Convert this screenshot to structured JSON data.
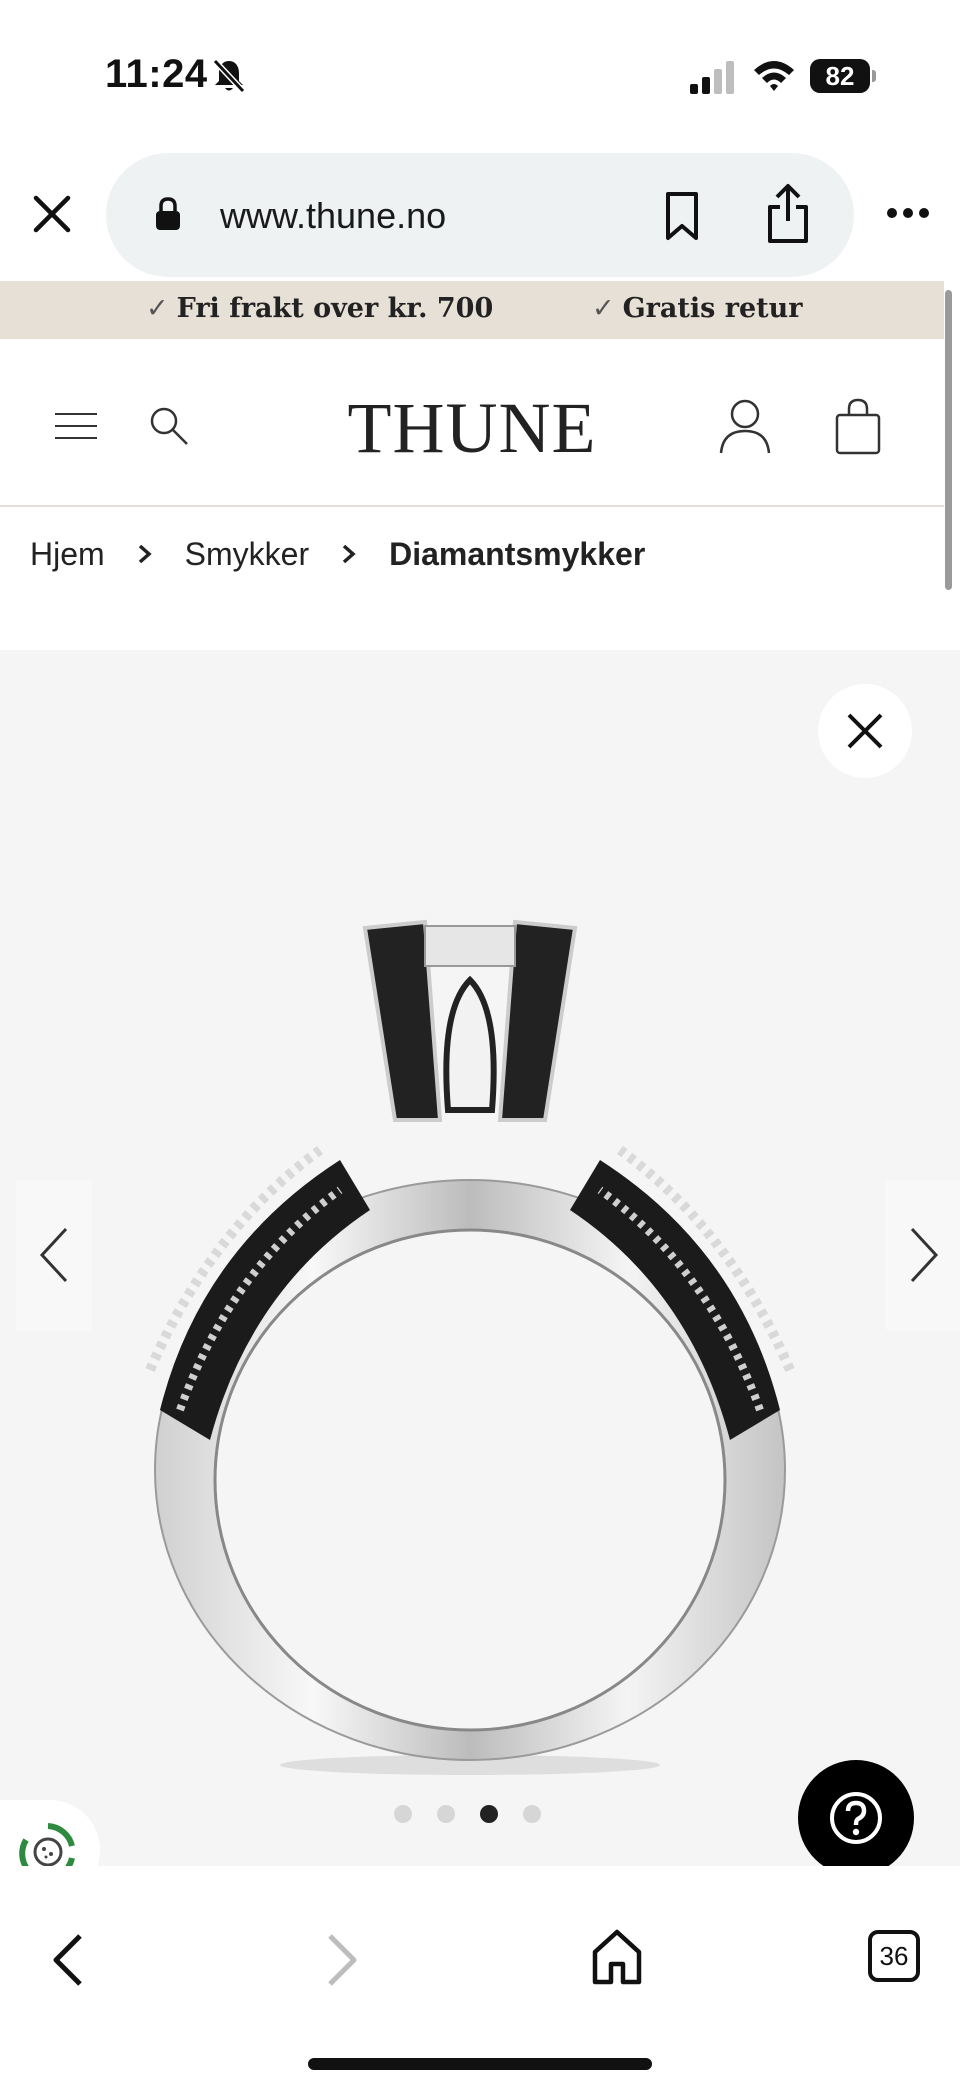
{
  "status_bar": {
    "time": "11:24",
    "battery": "82",
    "icons": [
      "silent-bell-icon",
      "signal-icon",
      "wifi-icon",
      "battery-icon"
    ]
  },
  "browser": {
    "url": "www.thune.no",
    "icons": [
      "close-icon",
      "lock-icon",
      "bookmark-icon",
      "share-icon",
      "more-icon"
    ]
  },
  "announcement": {
    "items": [
      {
        "check": "✓",
        "text": "Fri frakt over kr. 700"
      },
      {
        "check": "✓",
        "text": "Gratis retur"
      }
    ]
  },
  "header": {
    "logo": "THUNE",
    "icons": [
      "menu-icon",
      "search-icon",
      "account-icon",
      "bag-icon"
    ]
  },
  "breadcrumb": {
    "items": [
      "Hjem",
      "Smykker",
      "Diamantsmykker"
    ]
  },
  "gallery": {
    "image_description_icon": "ring-image",
    "dot_count": 4,
    "active_dot": 3
  },
  "toolbar": {
    "tabs_count": "36",
    "icons": [
      "back-icon",
      "forward-icon",
      "home-icon",
      "tabs-icon"
    ]
  },
  "colors": {
    "announcement_bg": "#e7e0d6",
    "gallery_bg": "#f5f5f5",
    "url_pill_bg": "#eff2f3"
  }
}
